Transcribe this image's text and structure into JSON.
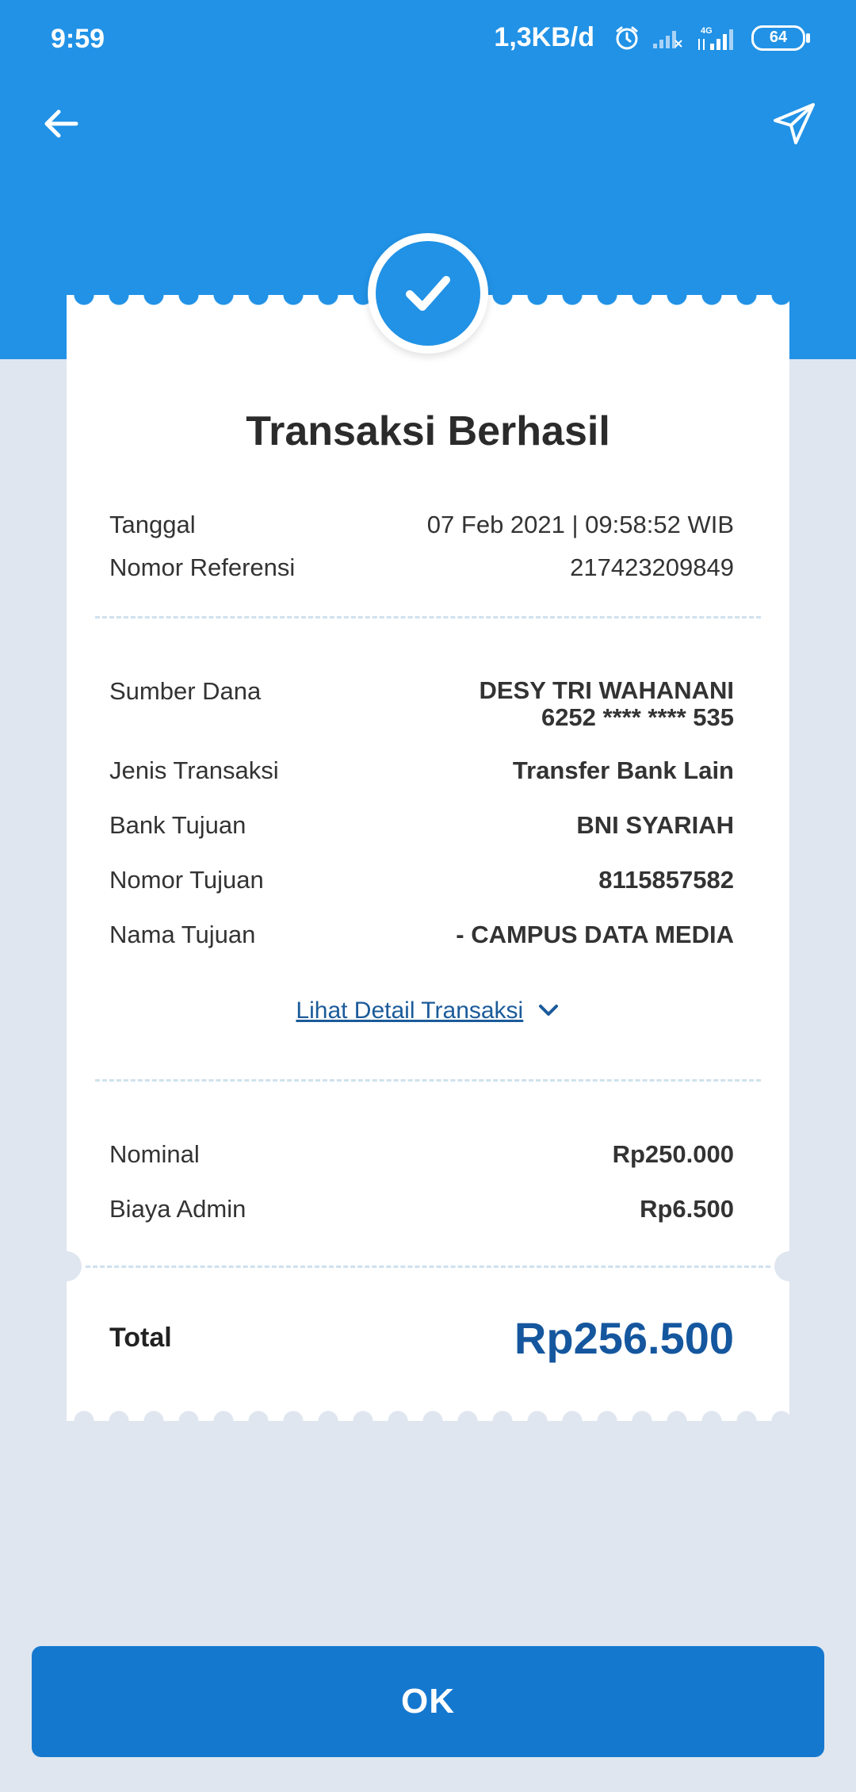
{
  "status_bar": {
    "time": "9:59",
    "net_speed": "1,3KB/d",
    "network": "4G",
    "battery": "64"
  },
  "toolbar": {
    "back_icon": "arrow-left-icon",
    "share_icon": "paper-plane-icon"
  },
  "receipt": {
    "title": "Transaksi Berhasil",
    "date_label": "Tanggal",
    "date_value": "07 Feb 2021 | 09:58:52 WIB",
    "ref_label": "Nomor Referensi",
    "ref_value": "217423209849",
    "source_label": "Sumber Dana",
    "source_name": "DESY TRI WAHANANI",
    "source_account": "6252 **** **** 535",
    "type_label": "Jenis Transaksi",
    "type_value": "Transfer Bank Lain",
    "bank_label": "Bank Tujuan",
    "bank_value": "BNI SYARIAH",
    "dest_no_label": "Nomor Tujuan",
    "dest_no_value": "8115857582",
    "dest_name_label": "Nama Tujuan",
    "dest_name_value": "- CAMPUS DATA MEDIA",
    "detail_link": "Lihat Detail Transaksi",
    "nominal_label": "Nominal",
    "nominal_value": "Rp250.000",
    "admin_label": "Biaya Admin",
    "admin_value": "Rp6.500",
    "total_label": "Total",
    "total_value": "Rp256.500"
  },
  "ok_button": "OK",
  "colors": {
    "brand_blue": "#2192e6",
    "button_blue": "#1578cf",
    "total_blue": "#15579e",
    "background": "#dfe6ef"
  }
}
